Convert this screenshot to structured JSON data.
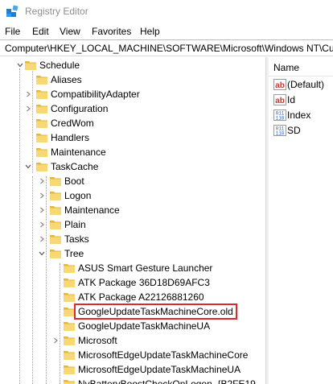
{
  "window": {
    "title": "Registry Editor",
    "icon": "registry-editor-icon"
  },
  "menu": [
    "File",
    "Edit",
    "View",
    "Favorites",
    "Help"
  ],
  "address": "Computer\\HKEY_LOCAL_MACHINE\\SOFTWARE\\Microsoft\\Windows NT\\CurrentVersion\\Schedule\\TaskCache\\Tree",
  "tree": [
    {
      "label": "Schedule",
      "depth": 0,
      "expander": "expanded"
    },
    {
      "label": "Aliases",
      "depth": 1,
      "expander": "none"
    },
    {
      "label": "CompatibilityAdapter",
      "depth": 1,
      "expander": "collapsed"
    },
    {
      "label": "Configuration",
      "depth": 1,
      "expander": "collapsed"
    },
    {
      "label": "CredWom",
      "depth": 1,
      "expander": "none"
    },
    {
      "label": "Handlers",
      "depth": 1,
      "expander": "none"
    },
    {
      "label": "Maintenance",
      "depth": 1,
      "expander": "none"
    },
    {
      "label": "TaskCache",
      "depth": 1,
      "expander": "expanded"
    },
    {
      "label": "Boot",
      "depth": 2,
      "expander": "collapsed"
    },
    {
      "label": "Logon",
      "depth": 2,
      "expander": "collapsed"
    },
    {
      "label": "Maintenance",
      "depth": 2,
      "expander": "collapsed"
    },
    {
      "label": "Plain",
      "depth": 2,
      "expander": "collapsed"
    },
    {
      "label": "Tasks",
      "depth": 2,
      "expander": "collapsed"
    },
    {
      "label": "Tree",
      "depth": 2,
      "expander": "expanded"
    },
    {
      "label": "ASUS Smart Gesture Launcher",
      "depth": 3,
      "expander": "none"
    },
    {
      "label": "ATK Package 36D18D69AFC3",
      "depth": 3,
      "expander": "none"
    },
    {
      "label": "ATK Package A22126881260",
      "depth": 3,
      "expander": "none"
    },
    {
      "label": "GoogleUpdateTaskMachineCore.old",
      "depth": 3,
      "expander": "none",
      "selected": true
    },
    {
      "label": "GoogleUpdateTaskMachineUA",
      "depth": 3,
      "expander": "none"
    },
    {
      "label": "Microsoft",
      "depth": 3,
      "expander": "collapsed"
    },
    {
      "label": "MicrosoftEdgeUpdateTaskMachineCore",
      "depth": 3,
      "expander": "none"
    },
    {
      "label": "MicrosoftEdgeUpdateTaskMachineUA",
      "depth": 3,
      "expander": "none"
    },
    {
      "label": "NvBatteryBoostCheckOnLogon_{B2FE19",
      "depth": 3,
      "expander": "none"
    }
  ],
  "values": {
    "header": "Name",
    "items": [
      {
        "name": "(Default)",
        "type": "string"
      },
      {
        "name": "Id",
        "type": "string"
      },
      {
        "name": "Index",
        "type": "binary"
      },
      {
        "name": "SD",
        "type": "binary"
      }
    ]
  },
  "colors": {
    "folder": "#f8d775",
    "folder_dark": "#e4b73f",
    "selection_outline": "#e3262c",
    "string_icon": "#c8362e",
    "binary_icon": "#2b63c4"
  }
}
